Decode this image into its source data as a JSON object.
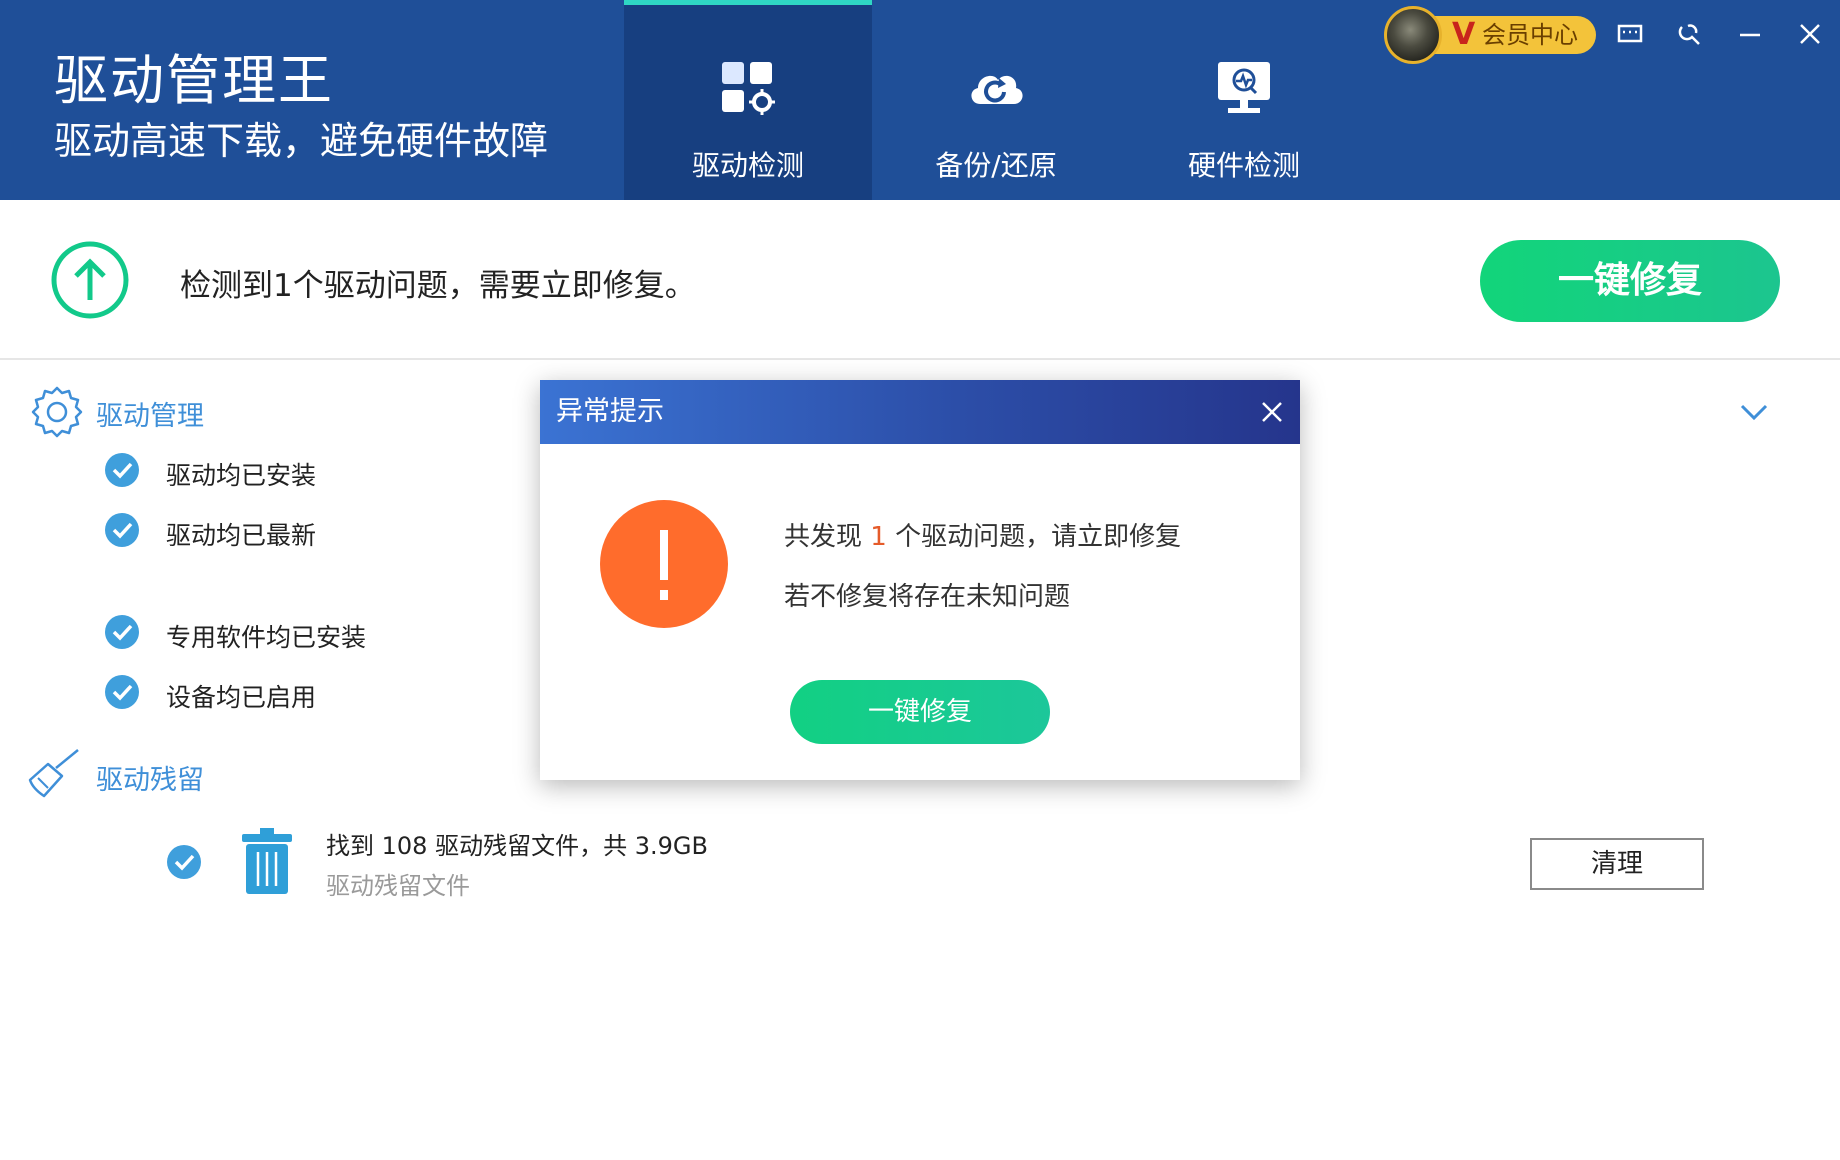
{
  "app": {
    "title": "驱动管理王",
    "subtitle": "驱动高速下载，避免硬件故障"
  },
  "nav": {
    "tabs": [
      {
        "label": "驱动检测",
        "icon": "driver-detect-icon",
        "active": true
      },
      {
        "label": "备份/还原",
        "icon": "cloud-backup-icon",
        "active": false
      },
      {
        "label": "硬件检测",
        "icon": "hardware-monitor-icon",
        "active": false
      }
    ]
  },
  "vip": {
    "badge": "V",
    "label": "会员中心"
  },
  "window_controls": [
    "feedback-icon",
    "tools-icon",
    "minimize-icon",
    "close-icon"
  ],
  "status": {
    "message": "检测到1个驱动问题，需要立即修复。",
    "fix_button": "一键修复"
  },
  "driver_management": {
    "title": "驱动管理",
    "items": [
      {
        "label": "驱动均已安装",
        "checked": true
      },
      {
        "label": "驱动均已最新",
        "checked": true
      },
      {
        "label": "专用软件均已安装",
        "checked": true
      },
      {
        "label": "设备均已启用",
        "checked": true
      }
    ]
  },
  "driver_residue": {
    "title": "驱动残留",
    "summary": "找到 108 驱动残留文件，共 3.9GB",
    "sublabel": "驱动残留文件",
    "clean_button": "清理"
  },
  "dialog": {
    "title": "异常提示",
    "line1_prefix": "共发现 ",
    "line1_count": "1",
    "line1_suffix": " 个驱动问题，请立即修复",
    "line2": "若不修复将存在未知问题",
    "fix_button": "一键修复"
  },
  "colors": {
    "header": "#1f4f98",
    "active_tab": "#173f80",
    "green": "#12d57a",
    "accent_blue": "#3f8fd8",
    "warning_orange": "#ff6c2c",
    "vip_gold": "#f3c33a"
  }
}
